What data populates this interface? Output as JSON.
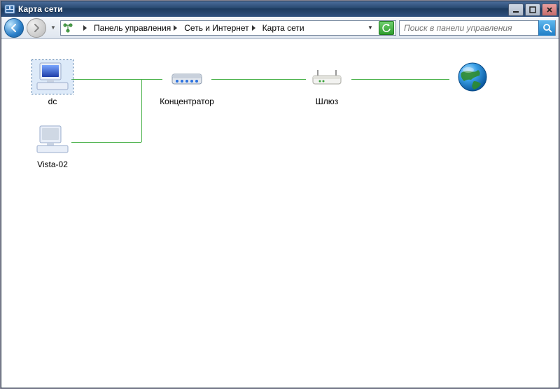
{
  "window": {
    "title": "Карта сети"
  },
  "breadcrumb": {
    "items": [
      {
        "label": "Панель управления"
      },
      {
        "label": "Сеть и Интернет"
      },
      {
        "label": "Карта сети"
      }
    ]
  },
  "search": {
    "placeholder": "Поиск в панели управления"
  },
  "nodes": {
    "dc": {
      "label": "dc"
    },
    "vista": {
      "label": "Vista-02"
    },
    "hub": {
      "label": "Концентратор"
    },
    "gate": {
      "label": "Шлюз"
    },
    "globe": {
      "label": ""
    }
  }
}
